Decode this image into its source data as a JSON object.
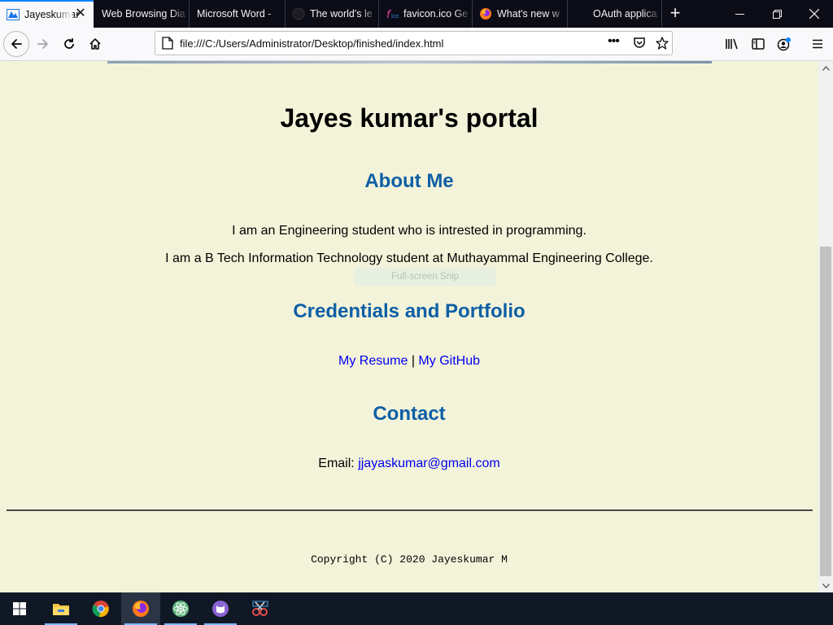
{
  "browser": {
    "tabs": [
      {
        "label": "Jayeskumar",
        "icon": "portal-favicon",
        "active": true
      },
      {
        "label": "Web Browsing Dia",
        "icon": "none",
        "active": false
      },
      {
        "label": "Microsoft Word - ",
        "icon": "none",
        "active": false
      },
      {
        "label": "The world's le",
        "icon": "github-icon",
        "active": false
      },
      {
        "label": "favicon.ico Ge",
        "icon": "favicon-generator-icon",
        "active": false
      },
      {
        "label": "What's new w",
        "icon": "firefox-icon",
        "active": false
      },
      {
        "label": "OAuth applica",
        "icon": "none",
        "active": false
      }
    ],
    "url": "file:///C:/Users/Administrator/Desktop/finished/index.html"
  },
  "page": {
    "title": "Jayes kumar's portal",
    "about": {
      "heading": "About Me",
      "line1": "I am an Engineering student who is intrested in programming.",
      "line2": "I am a B Tech Information Technology student at Muthayammal Engineering College."
    },
    "overlay_text": "Full-screen Snip",
    "credentials": {
      "heading": "Credentials and Portfolio",
      "resume_link": "My Resume",
      "separator": "|",
      "github_link": "My GitHub"
    },
    "contact": {
      "heading": "Contact",
      "email_label": "Email:",
      "email": "jjayaskumar@gmail.com"
    },
    "copyright": "Copyright (C) 2020 Jayeskumar M"
  },
  "colors": {
    "page_background": "#f3f3da",
    "heading_blue": "#0e5fa5",
    "link_blue": "#0000ee"
  },
  "taskbar": {
    "items": [
      "windows-start-icon",
      "file-explorer-icon",
      "chrome-icon",
      "firefox-icon",
      "atom-icon",
      "github-desktop-icon",
      "snipping-tool-icon"
    ]
  }
}
